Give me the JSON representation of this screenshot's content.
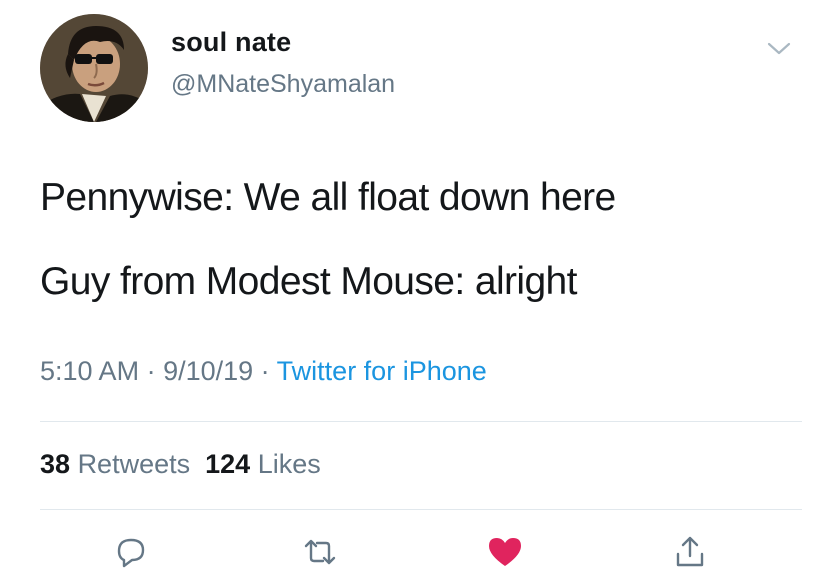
{
  "tweet": {
    "author": {
      "display_name": "soul nate",
      "handle": "@MNateShyamalan",
      "avatar": "portrait-avatar"
    },
    "lines": [
      "Pennywise: We all float down here",
      "Guy from Modest Mouse: alright"
    ],
    "time": "5:10 AM",
    "date": "9/10/19",
    "separator": " · ",
    "source": "Twitter for iPhone",
    "stats": {
      "retweets_count": "38",
      "retweets_label": "Retweets",
      "likes_count": "124",
      "likes_label": "Likes"
    }
  },
  "actions": [
    {
      "icon": "reply-icon"
    },
    {
      "icon": "retweet-icon"
    },
    {
      "icon": "heart-icon",
      "liked": true
    },
    {
      "icon": "share-icon"
    }
  ],
  "colors": {
    "text": "#14171a",
    "secondary": "#657786",
    "link": "#1b95e0",
    "like": "#e0245e",
    "divider": "#e1e8ed"
  }
}
